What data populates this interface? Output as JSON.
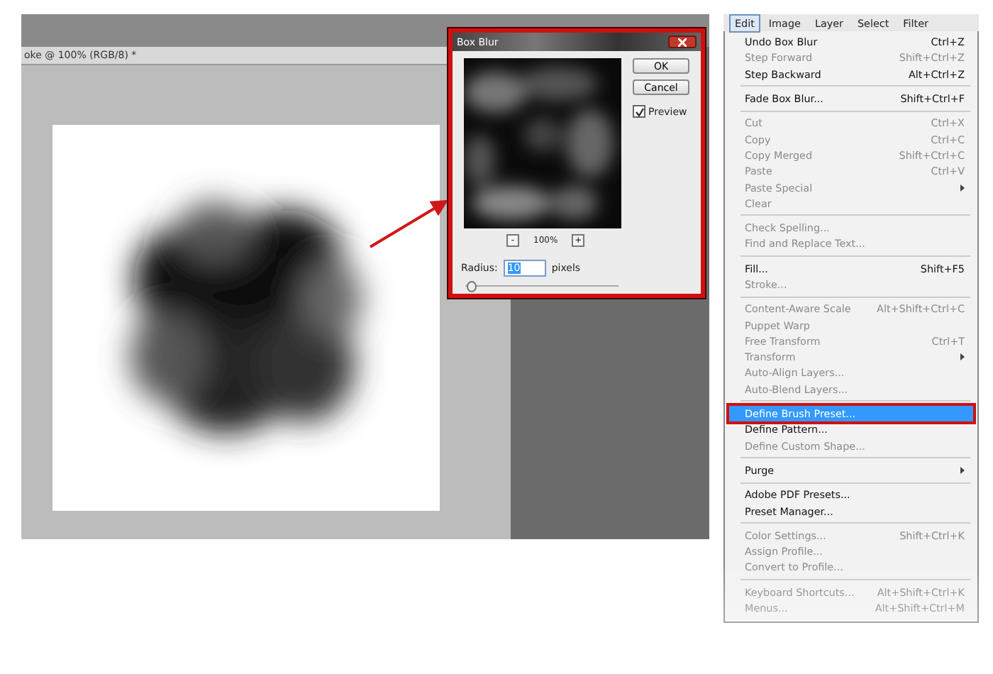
{
  "document": {
    "title": "oke @ 100% (RGB/8) *"
  },
  "dialog": {
    "title": "Box Blur",
    "buttons": [
      "OK",
      "Cancel"
    ],
    "preview": {
      "label": "Preview",
      "checked": true
    },
    "zoom": {
      "out": "-",
      "level": "100%",
      "in": "+"
    },
    "radius": {
      "label": "Radius:",
      "value": "10",
      "unit": "pixels",
      "level": 0.04
    }
  },
  "menu_bar": [
    {
      "label": "Edit",
      "selected": true
    },
    {
      "label": "Image",
      "selected": false
    },
    {
      "label": "Layer",
      "selected": false
    },
    {
      "label": "Select",
      "selected": false
    },
    {
      "label": "Filter",
      "selected": false
    }
  ],
  "menu": {
    "groups": [
      [
        {
          "label": "Undo Box Blur",
          "shortcut": "Ctrl+Z",
          "disabled": false,
          "submenu": false,
          "selected": false
        },
        {
          "label": "Step Forward",
          "shortcut": "Shift+Ctrl+Z",
          "disabled": true,
          "submenu": false,
          "selected": false
        },
        {
          "label": "Step Backward",
          "shortcut": "Alt+Ctrl+Z",
          "disabled": false,
          "submenu": false,
          "selected": false
        }
      ],
      [
        {
          "label": "Fade Box Blur...",
          "shortcut": "Shift+Ctrl+F",
          "disabled": false,
          "submenu": false,
          "selected": false
        }
      ],
      [
        {
          "label": "Cut",
          "shortcut": "Ctrl+X",
          "disabled": true,
          "submenu": false,
          "selected": false
        },
        {
          "label": "Copy",
          "shortcut": "Ctrl+C",
          "disabled": true,
          "submenu": false,
          "selected": false
        },
        {
          "label": "Copy Merged",
          "shortcut": "Shift+Ctrl+C",
          "disabled": true,
          "submenu": false,
          "selected": false
        },
        {
          "label": "Paste",
          "shortcut": "Ctrl+V",
          "disabled": true,
          "submenu": false,
          "selected": false
        },
        {
          "label": "Paste Special",
          "disabled": true,
          "submenu": true,
          "selected": false
        },
        {
          "label": "Clear",
          "disabled": true,
          "submenu": false,
          "selected": false
        }
      ],
      [
        {
          "label": "Check Spelling...",
          "disabled": true,
          "submenu": false,
          "selected": false
        },
        {
          "label": "Find and Replace Text...",
          "disabled": true,
          "submenu": false,
          "selected": false
        }
      ],
      [
        {
          "label": "Fill...",
          "shortcut": "Shift+F5",
          "disabled": false,
          "submenu": false,
          "selected": false
        },
        {
          "label": "Stroke...",
          "disabled": true,
          "submenu": false,
          "selected": false
        }
      ],
      [
        {
          "label": "Content-Aware Scale",
          "shortcut": "Alt+Shift+Ctrl+C",
          "disabled": true,
          "submenu": false,
          "selected": false
        },
        {
          "label": "Puppet Warp",
          "disabled": true,
          "submenu": false,
          "selected": false
        },
        {
          "label": "Free Transform",
          "shortcut": "Ctrl+T",
          "disabled": true,
          "submenu": false,
          "selected": false
        },
        {
          "label": "Transform",
          "disabled": true,
          "submenu": true,
          "selected": false
        },
        {
          "label": "Auto-Align Layers...",
          "disabled": true,
          "submenu": false,
          "selected": false
        },
        {
          "label": "Auto-Blend Layers...",
          "disabled": true,
          "submenu": false,
          "selected": false
        }
      ],
      [
        {
          "label": "Define Brush Preset...",
          "disabled": false,
          "submenu": false,
          "selected": true
        },
        {
          "label": "Define Pattern...",
          "disabled": false,
          "submenu": false,
          "selected": false
        },
        {
          "label": "Define Custom Shape...",
          "disabled": true,
          "submenu": false,
          "selected": false
        }
      ],
      [
        {
          "label": "Purge",
          "disabled": false,
          "submenu": true,
          "selected": false
        }
      ],
      [
        {
          "label": "Adobe PDF Presets...",
          "disabled": false,
          "submenu": false,
          "selected": false
        },
        {
          "label": "Preset Manager...",
          "disabled": false,
          "submenu": false,
          "selected": false
        }
      ],
      [
        {
          "label": "Color Settings...",
          "shortcut": "Shift+Ctrl+K",
          "disabled": true,
          "submenu": false,
          "selected": false
        },
        {
          "label": "Assign Profile...",
          "disabled": true,
          "submenu": false,
          "selected": false
        },
        {
          "label": "Convert to Profile...",
          "disabled": true,
          "submenu": false,
          "selected": false
        }
      ],
      [
        {
          "label": "Keyboard Shortcuts...",
          "shortcut": "Alt+Shift+Ctrl+K",
          "disabled": true,
          "submenu": false,
          "selected": false
        },
        {
          "label": "Menus...",
          "shortcut": "Alt+Shift+Ctrl+M",
          "disabled": true,
          "submenu": false,
          "selected": false
        }
      ]
    ]
  }
}
